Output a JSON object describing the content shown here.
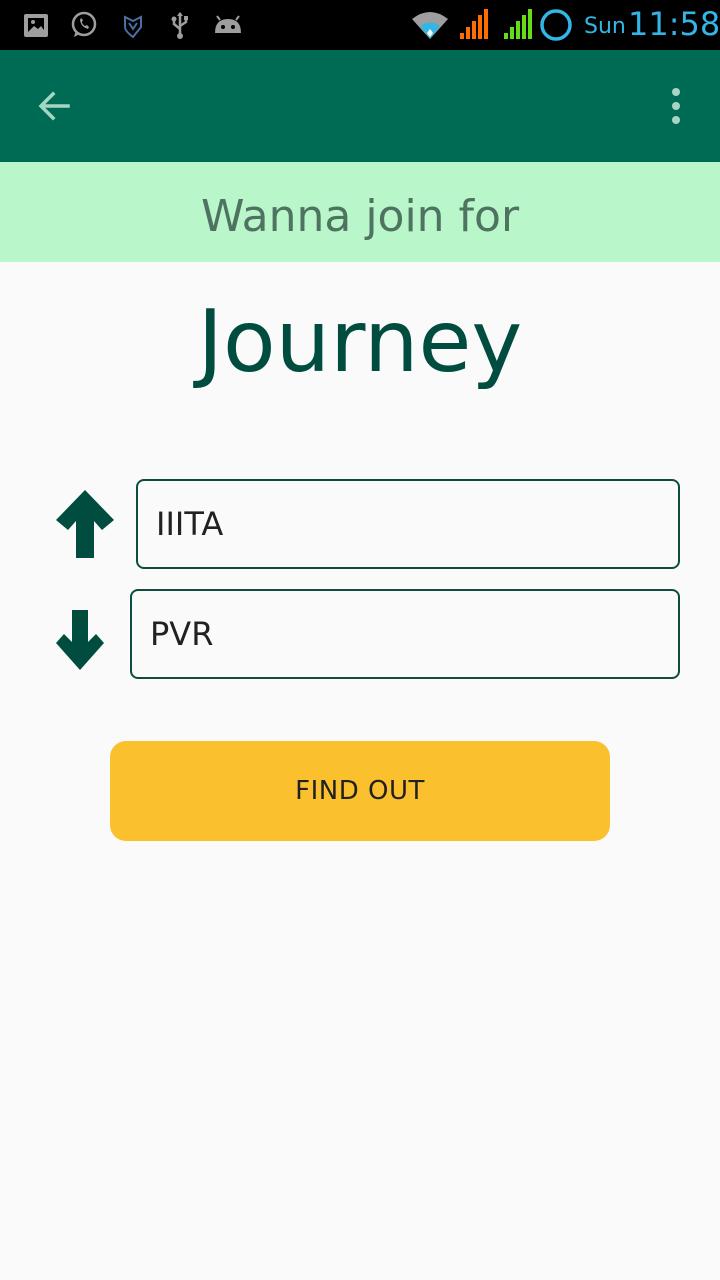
{
  "status_bar": {
    "icons": [
      "gallery-icon",
      "whatsapp-icon",
      "vpn-icon",
      "usb-icon",
      "android-icon",
      "wifi-icon",
      "signal-icon",
      "signal-icon-2",
      "sync-ring-icon"
    ],
    "day": "Sun",
    "time": "11:58",
    "time_color": "#33b5e5",
    "signal_colors": [
      "#ff6d00",
      "#64dd17"
    ]
  },
  "app_bar": {
    "color": "#006b54",
    "back_icon": "arrow-back-icon",
    "menu_icon": "more-vert-icon"
  },
  "banner": {
    "text": "Wanna join for",
    "color": "#b9f6ca"
  },
  "title": "Journey",
  "form": {
    "from": {
      "icon": "arrow-up-icon",
      "value": "IIITA"
    },
    "to": {
      "icon": "arrow-down-icon",
      "value": "PVR"
    },
    "submit_label": "FIND OUT",
    "submit_color": "#fbc02d"
  }
}
